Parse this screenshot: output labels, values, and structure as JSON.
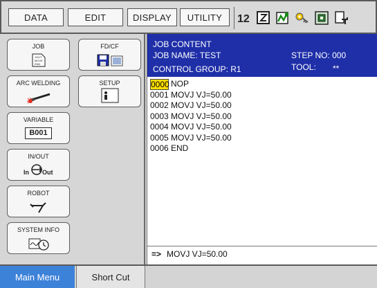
{
  "menu": {
    "data_label": "DATA",
    "edit_label": "EDIT",
    "display_label": "DISPLAY",
    "utility_label": "UTILITY"
  },
  "status_icons": [
    "tool-number-icon",
    "teach-mode-icon",
    "robot-status-icon",
    "key-icon",
    "module-icon",
    "document-edit-icon"
  ],
  "tiles": {
    "job": {
      "label": "JOB",
      "icon_lines": [
        "JOUT",
        "MOVE",
        "END"
      ]
    },
    "fdcf": {
      "label": "FD/CF"
    },
    "arc": {
      "label": "ARC WELDING"
    },
    "setup": {
      "label": "SETUP"
    },
    "variable": {
      "label": "VARIABLE",
      "value": "B001"
    },
    "inout": {
      "label": "IN/OUT",
      "in": "In",
      "out": "Out"
    },
    "robot": {
      "label": "ROBOT"
    },
    "sysinfo": {
      "label": "SYSTEM INFO"
    }
  },
  "job": {
    "content_title": "JOB CONTENT",
    "job_name": "JOB NAME: TEST",
    "control_group": "CONTROL GROUP: R1",
    "step_no": "STEP NO: 000",
    "tool_label": "TOOL:",
    "tool_value": "**",
    "lines": [
      {
        "num": "0000",
        "text": "NOP"
      },
      {
        "num": "0001",
        "text": "MOVJ VJ=50.00"
      },
      {
        "num": "0002",
        "text": "MOVJ VJ=50.00"
      },
      {
        "num": "0003",
        "text": "MOVJ VJ=50.00"
      },
      {
        "num": "0004",
        "text": "MOVJ VJ=50.00"
      },
      {
        "num": "0005",
        "text": "MOVJ VJ=50.00"
      },
      {
        "num": "0006",
        "text": "END"
      }
    ],
    "input_prefix": "=>",
    "input_value": "MOVJ VJ=50.00"
  },
  "bottom": {
    "main_menu": "Main Menu",
    "short_cut": "Short Cut"
  },
  "colors": {
    "header_bg": "#1f2fa8",
    "selection": "#ffde00",
    "active_tab": "#3d82d9"
  }
}
